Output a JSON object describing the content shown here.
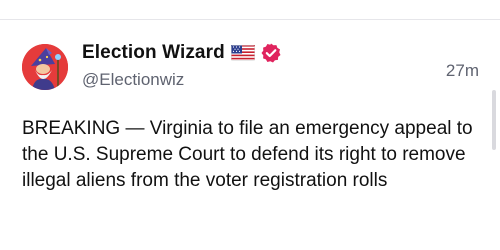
{
  "post": {
    "author": {
      "display_name": "Election Wizard",
      "handle": "@Electionwiz",
      "flag_icon": "us-flag-icon",
      "verified_icon": "verified-badge-icon",
      "verified_color": "#e0245e",
      "avatar_color": "#e53b3b"
    },
    "timestamp": "27m",
    "text": "BREAKING — Virginia to file an emergency appeal to the U.S. Supreme Court to defend its right to remove illegal aliens from the voter registration rolls"
  }
}
